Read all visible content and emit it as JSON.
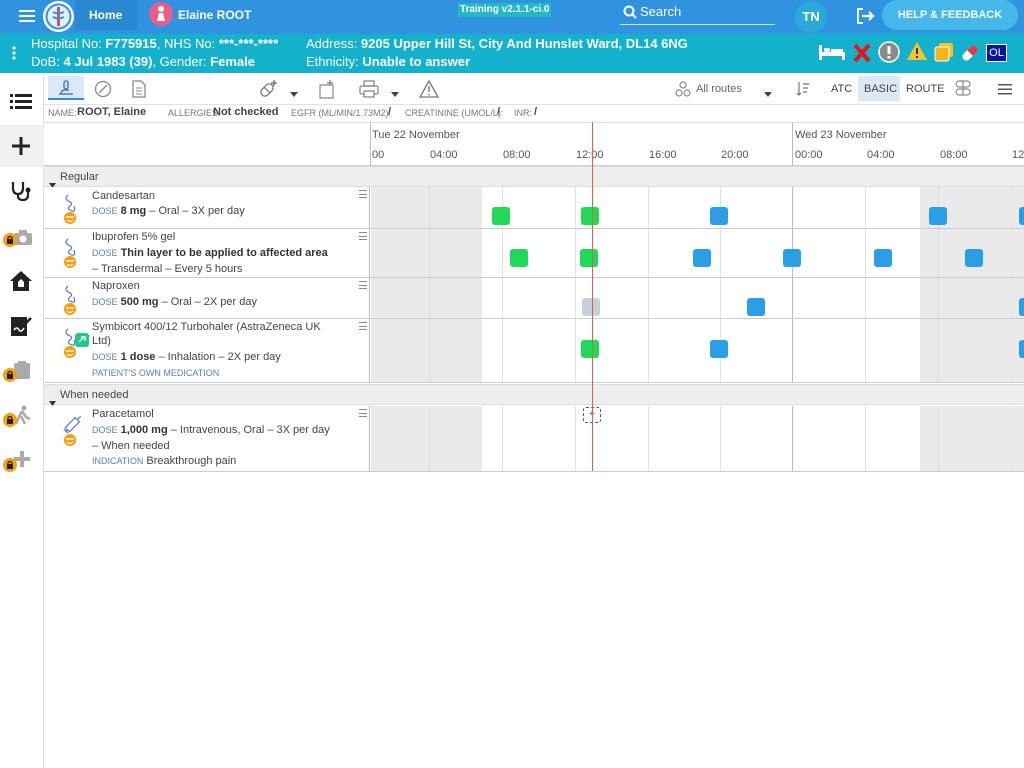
{
  "topbar": {
    "home": "Home",
    "patient_short": "Elaine ROOT",
    "env": "Training v2.1.1-ci.0",
    "search_placeholder": "Search",
    "user_initials": "TN",
    "help": "HELP & FEEDBACK"
  },
  "patient": {
    "line1_prefix": "Hospital No: ",
    "hospital_no": "F775915",
    "nhs_label": ", NHS No: ",
    "nhs_no": "***-***-****",
    "line2_prefix": "DoB: ",
    "dob": "4 Jul 1983 (39)",
    "gender_label": ", Gender: ",
    "gender": "Female",
    "address_label": "Address: ",
    "address": "9205 Upper Hill St, City And Hunslet Ward, DL14 6NG",
    "ethnicity_label": "Ethnicity: ",
    "ethnicity": "Unable to answer",
    "badge": "OL"
  },
  "toolbar": {
    "routes": "All routes",
    "atc": "ATC",
    "basic": "BASIC",
    "route": "ROUTE"
  },
  "infobar": {
    "name_label": "NAME:",
    "name": "ROOT, Elaine",
    "allergies_label": "ALLERGIES:",
    "allergies": "Not checked",
    "egfr_label": "EGFR (ML/MIN/1.73M2):",
    "egfr": "/",
    "creat_label": "CREATININE (UMOL/L):",
    "creat": "/",
    "inr_label": "INR:",
    "inr": "/"
  },
  "timeline": {
    "day1": "Tue 22 November",
    "day2": "Wed 23 November",
    "ticks": [
      "00",
      "04:00",
      "08:00",
      "12:00",
      "16:00",
      "20:00",
      "00:00",
      "04:00",
      "08:00",
      "12"
    ]
  },
  "sections": {
    "regular": "Regular",
    "when_needed": "When needed"
  },
  "meds": [
    {
      "name": "Candesartan",
      "dose_label": "DOSE",
      "dose": "8 mg",
      "rest": " – Oral – 3X per day",
      "rest2": "",
      "extra_label": "",
      "extra": ""
    },
    {
      "name": "Ibuprofen 5% gel",
      "dose_label": "DOSE",
      "dose": "Thin layer to be applied to affected area",
      "rest": "",
      "rest2": "– Transdermal – Every 5 hours",
      "extra_label": "",
      "extra": ""
    },
    {
      "name": "Naproxen",
      "dose_label": "DOSE",
      "dose": "500 mg",
      "rest": " – Oral – 2X per day",
      "rest2": "",
      "extra_label": "",
      "extra": ""
    },
    {
      "name": "Symbicort 400/12 Turbohaler (AstraZeneca UK",
      "name2": "Ltd)",
      "dose_label": "DOSE",
      "dose": "1 dose",
      "rest": " – Inhalation – 2X per day",
      "rest2": "",
      "extra_label": "PATIENT'S OWN MEDICATION",
      "extra": ""
    },
    {
      "name": "Paracetamol",
      "dose_label": "DOSE",
      "dose": "1,000 mg",
      "rest": " – Intravenous, Oral – 3X per day",
      "rest2": "– When needed",
      "extra_label": "INDICATION",
      "extra": "Breakthrough pain"
    }
  ],
  "prn_add": "+",
  "colors": {
    "given": "#22d858",
    "scheduled": "#2b9ee6",
    "pending": "#c4d0dc",
    "now_line": "#e06040"
  }
}
